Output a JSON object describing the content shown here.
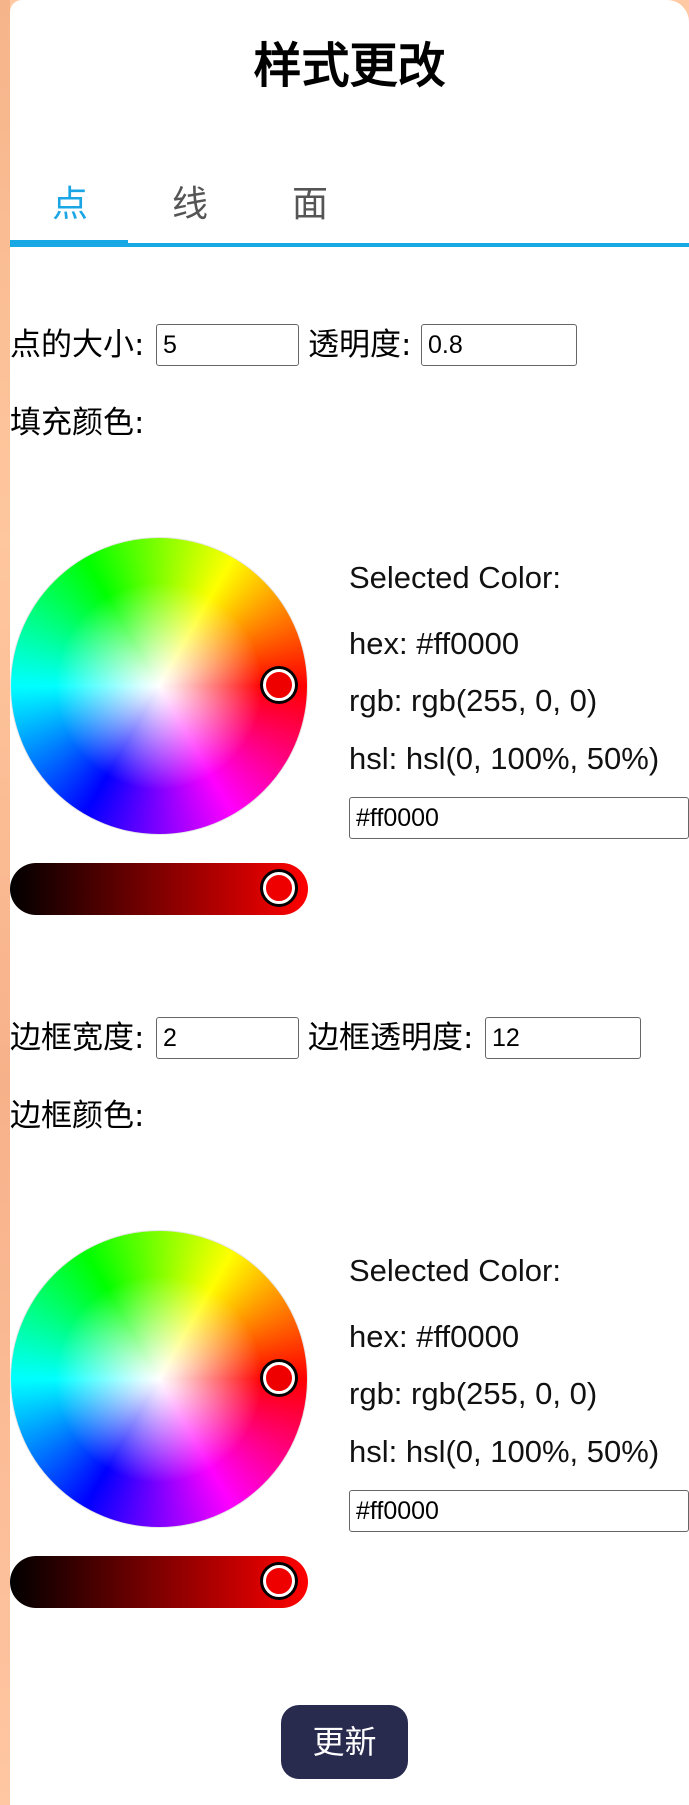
{
  "title": "样式更改",
  "tabs": [
    {
      "label": "点",
      "active": true
    },
    {
      "label": "线",
      "active": false
    },
    {
      "label": "面",
      "active": false
    }
  ],
  "point": {
    "size_label": "点的大小:",
    "size_value": "5",
    "opacity_label": "透明度:",
    "opacity_value": "0.8",
    "fill_color_label": "填充颜色:"
  },
  "fill_picker": {
    "selected_label": "Selected Color:",
    "hex_text": "hex: #ff0000",
    "rgb_text": "rgb: rgb(255, 0, 0)",
    "hsl_text": "hsl: hsl(0, 100%, 50%)",
    "hex_input": "#ff0000",
    "handle_color": "#ee0000"
  },
  "border": {
    "width_label": "边框宽度:",
    "width_value": "2",
    "opacity_label": "边框透明度:",
    "opacity_value": "12",
    "color_label": "边框颜色:"
  },
  "border_picker": {
    "selected_label": "Selected Color:",
    "hex_text": "hex: #ff0000",
    "rgb_text": "rgb: rgb(255, 0, 0)",
    "hsl_text": "hsl: hsl(0, 100%, 50%)",
    "hex_input": "#ff0000",
    "handle_color": "#ee0000"
  },
  "update_button": "更新",
  "colors": {
    "accent": "#18a9e4",
    "button_bg": "#282a4e",
    "side_strip": "#ffc9a3"
  }
}
